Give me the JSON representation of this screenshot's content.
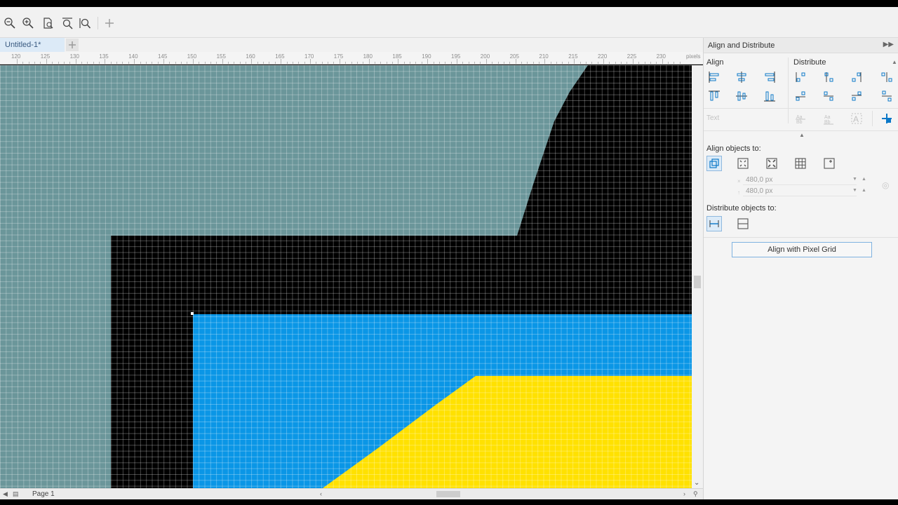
{
  "tabs": {
    "document": "Untitled-1*"
  },
  "ruler": {
    "labels": [
      "120",
      "125",
      "130",
      "135",
      "140",
      "145",
      "150",
      "155",
      "160",
      "165",
      "170",
      "175",
      "180",
      "185",
      "190",
      "195",
      "200",
      "205",
      "210",
      "215",
      "220",
      "225",
      "230"
    ],
    "unit": "pixels"
  },
  "status": {
    "page": "Page 1"
  },
  "panel": {
    "title": "Align and Distribute",
    "align_label": "Align",
    "distribute_label": "Distribute",
    "text_label": "Text",
    "align_to_label": "Align objects to:",
    "x_value": "480,0 px",
    "y_value": "480,0 px",
    "distribute_to_label": "Distribute objects to:",
    "pixel_grid_button": "Align with Pixel Grid"
  },
  "colors": {
    "background": "#6b969a",
    "black": "#000000",
    "blue": "#0a96e6",
    "yellow": "#ffe100"
  }
}
